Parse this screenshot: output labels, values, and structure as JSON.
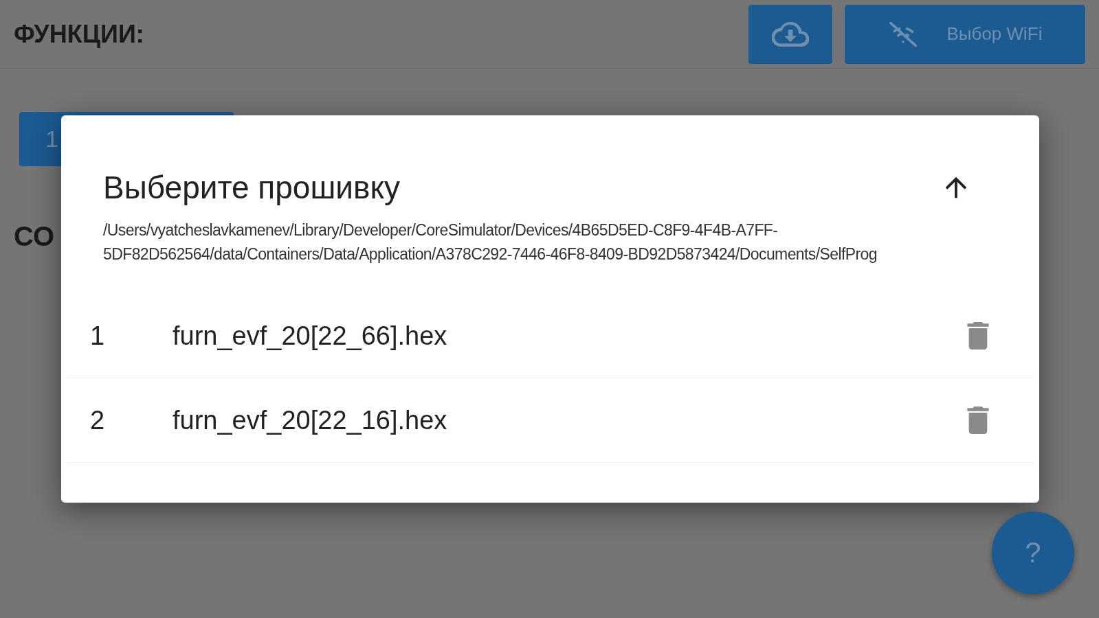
{
  "page": {
    "heading": "ФУНКЦИИ:",
    "wifi_button": {
      "label": "Выбор WiFi"
    },
    "tab": {
      "label": "1"
    },
    "section_heading": "СО",
    "help_button": {
      "label": "?"
    }
  },
  "dialog": {
    "title": "Выберите прошивку",
    "path": "/Users/vyatcheslavkamenev/Library/Developer/CoreSimulator/Devices/4B65D5ED-C8F9-4F4B-A7FF-5DF82D562564/data/Containers/Data/Application/A378C292-7446-46F8-8409-BD92D5873424/Documents/SelfProg",
    "files": [
      {
        "index": "1",
        "name": "furn_evf_20[22_66].hex"
      },
      {
        "index": "2",
        "name": "furn_evf_20[22_16].hex"
      }
    ]
  }
}
